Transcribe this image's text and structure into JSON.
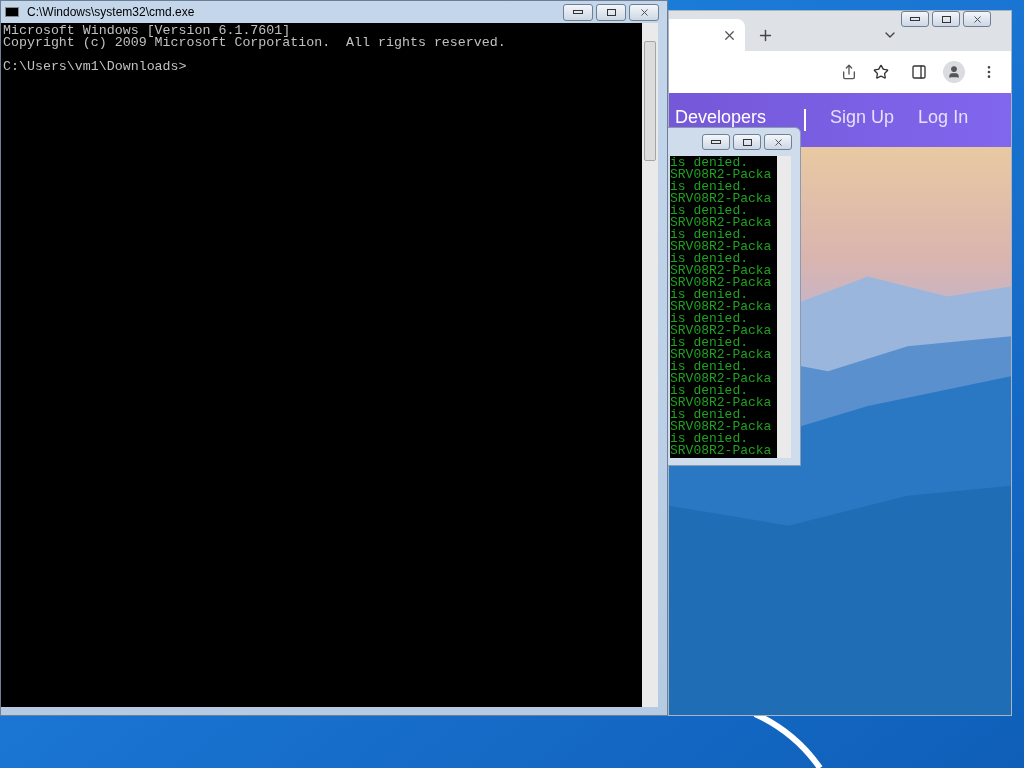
{
  "cmd_window": {
    "title": "C:\\Windows\\system32\\cmd.exe",
    "lines": [
      {
        "text": "Microsoft Windows [Version 6.1.7601]",
        "kind": "output"
      },
      {
        "text": "Copyright (c) 2009 Microsoft Corporation.  All rights reserved.",
        "kind": "output"
      },
      {
        "text": "C:\\Users\\vm1\\Downloads>",
        "kind": "prompt"
      }
    ]
  },
  "browser": {
    "nav_links": [
      {
        "label": "Developers",
        "kind": "divided"
      },
      {
        "label": "Sign Up",
        "kind": "plain"
      },
      {
        "label": "Log In",
        "kind": "plain"
      }
    ]
  },
  "console_window": {
    "lines": [
      "is denied.",
      "SRV08R2-Packa",
      "is denied.",
      "SRV08R2-Packa",
      "is denied.",
      "SRV08R2-Packa",
      "is denied.",
      "SRV08R2-Packa",
      "is denied.",
      "SRV08R2-Packa",
      "SRV08R2-Packa",
      "is denied.",
      "SRV08R2-Packa",
      "is denied.",
      "SRV08R2-Packa",
      "is denied.",
      "SRV08R2-Packa",
      "is denied.",
      "SRV08R2-Packa",
      "is denied.",
      "SRV08R2-Packa",
      "is denied.",
      "SRV08R2-Packa",
      "is denied.",
      "SRV08R2-Packa"
    ]
  }
}
